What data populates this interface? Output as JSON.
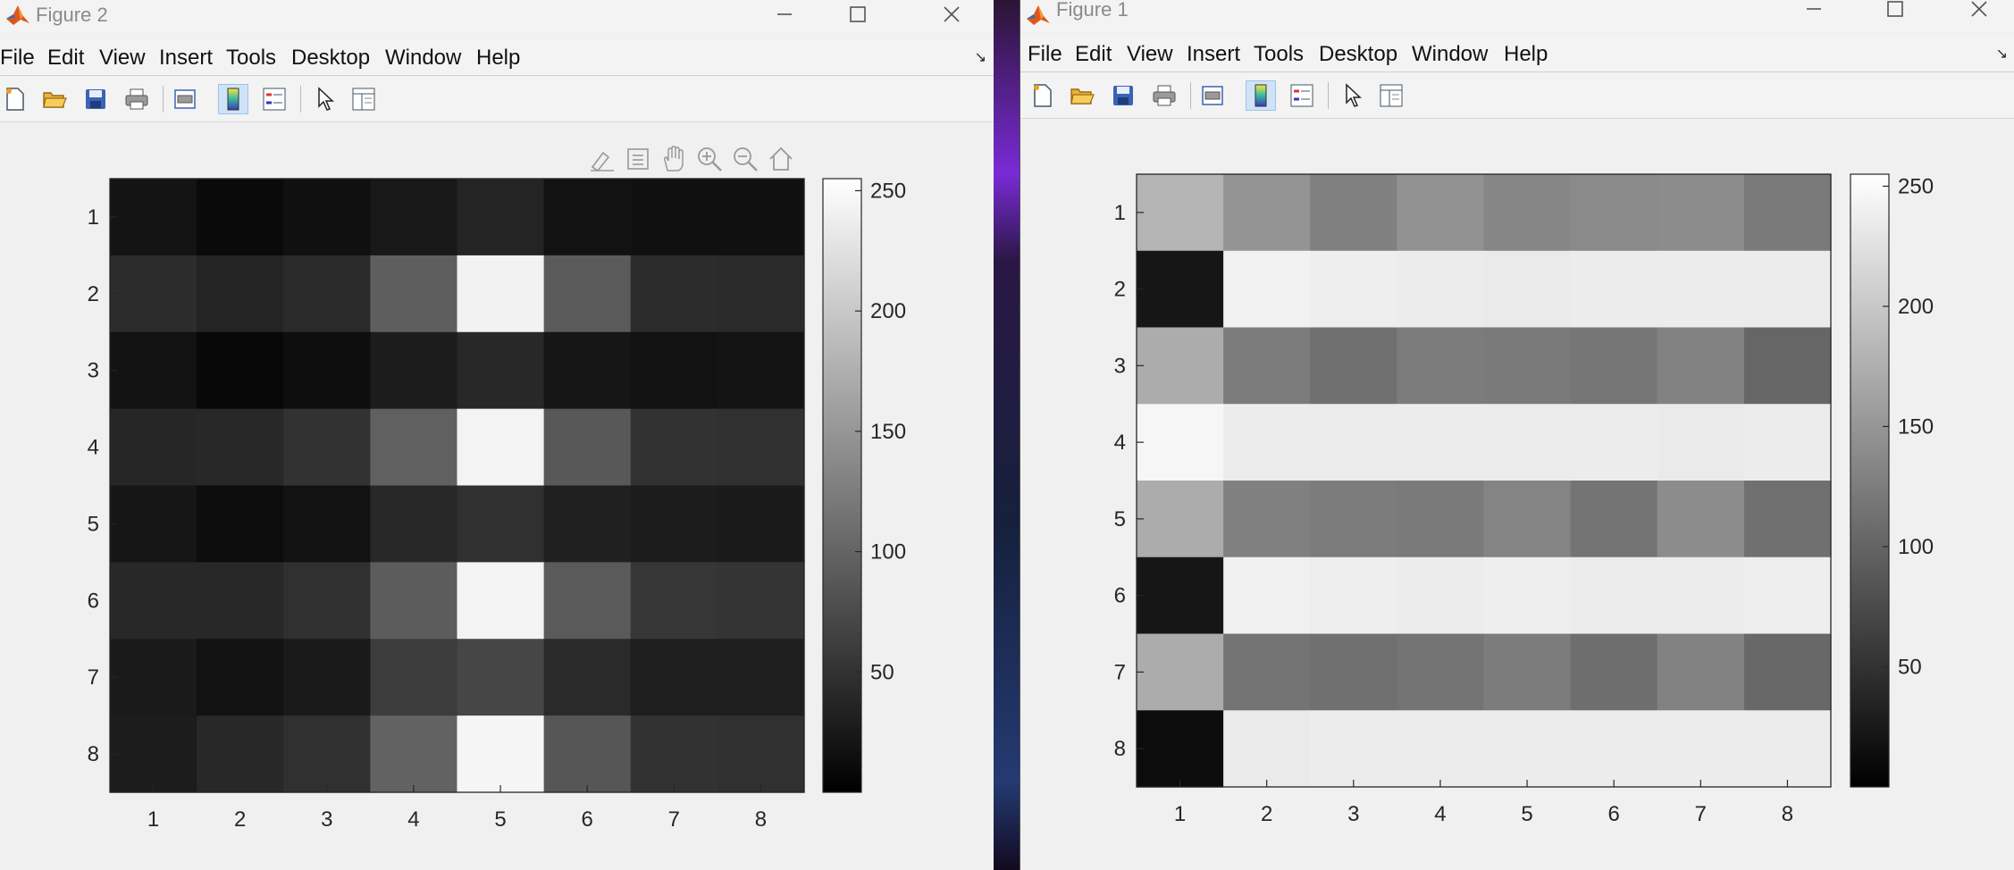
{
  "windows": [
    {
      "id": "win2",
      "title": "Figure 2",
      "menus": [
        "File",
        "Edit",
        "View",
        "Insert",
        "Tools",
        "Desktop",
        "Window",
        "Help"
      ],
      "chart_data": {
        "type": "heatmap",
        "colormap": "gray",
        "x_categories": [
          "1",
          "2",
          "3",
          "4",
          "5",
          "6",
          "7",
          "8"
        ],
        "y_categories": [
          "1",
          "2",
          "3",
          "4",
          "5",
          "6",
          "7",
          "8"
        ],
        "values": [
          [
            20,
            10,
            16,
            24,
            36,
            18,
            16,
            16
          ],
          [
            44,
            36,
            42,
            94,
            242,
            90,
            44,
            42
          ],
          [
            18,
            8,
            14,
            28,
            40,
            22,
            18,
            20
          ],
          [
            38,
            40,
            50,
            96,
            243,
            88,
            50,
            48
          ],
          [
            22,
            12,
            18,
            40,
            48,
            32,
            28,
            26
          ],
          [
            40,
            40,
            48,
            92,
            243,
            90,
            54,
            52
          ],
          [
            26,
            18,
            26,
            60,
            70,
            42,
            30,
            30
          ],
          [
            28,
            40,
            48,
            98,
            245,
            86,
            50,
            48
          ]
        ],
        "colorbar": {
          "clim": [
            0,
            255
          ],
          "ticks": [
            50,
            100,
            150,
            200,
            250
          ],
          "tick_labels": [
            "50",
            "100",
            "150",
            "200",
            "250"
          ]
        }
      }
    },
    {
      "id": "win1",
      "title": "Figure 1",
      "menus": [
        "File",
        "Edit",
        "View",
        "Insert",
        "Tools",
        "Desktop",
        "Window",
        "Help"
      ],
      "chart_data": {
        "type": "heatmap",
        "colormap": "gray",
        "x_categories": [
          "1",
          "2",
          "3",
          "4",
          "5",
          "6",
          "7",
          "8"
        ],
        "y_categories": [
          "1",
          "2",
          "3",
          "4",
          "5",
          "6",
          "7",
          "8"
        ],
        "values": [
          [
            180,
            148,
            128,
            146,
            134,
            138,
            140,
            122
          ],
          [
            22,
            242,
            238,
            236,
            234,
            236,
            236,
            236
          ],
          [
            172,
            124,
            112,
            124,
            122,
            118,
            130,
            102
          ],
          [
            246,
            236,
            236,
            236,
            236,
            236,
            234,
            236
          ],
          [
            172,
            128,
            124,
            122,
            132,
            116,
            140,
            112
          ],
          [
            22,
            240,
            238,
            236,
            238,
            236,
            236,
            238
          ],
          [
            172,
            116,
            112,
            116,
            124,
            110,
            130,
            104
          ],
          [
            12,
            234,
            236,
            236,
            236,
            236,
            236,
            236
          ]
        ],
        "colorbar": {
          "clim": [
            0,
            255
          ],
          "ticks": [
            50,
            100,
            150,
            200,
            250
          ],
          "tick_labels": [
            "50",
            "100",
            "150",
            "200",
            "250"
          ]
        }
      }
    }
  ],
  "toolbar_icons": [
    "new-figure-icon",
    "open-file-icon",
    "save-icon",
    "print-icon",
    "print-preview-icon",
    "toggle-colorbar-icon",
    "insert-legend-icon",
    "edit-plot-pointer-icon",
    "property-inspector-icon"
  ],
  "axes_toolbar_icons": [
    "brush-icon",
    "datatip-icon",
    "pan-hand-icon",
    "zoom-in-icon",
    "zoom-out-icon",
    "home-icon"
  ]
}
